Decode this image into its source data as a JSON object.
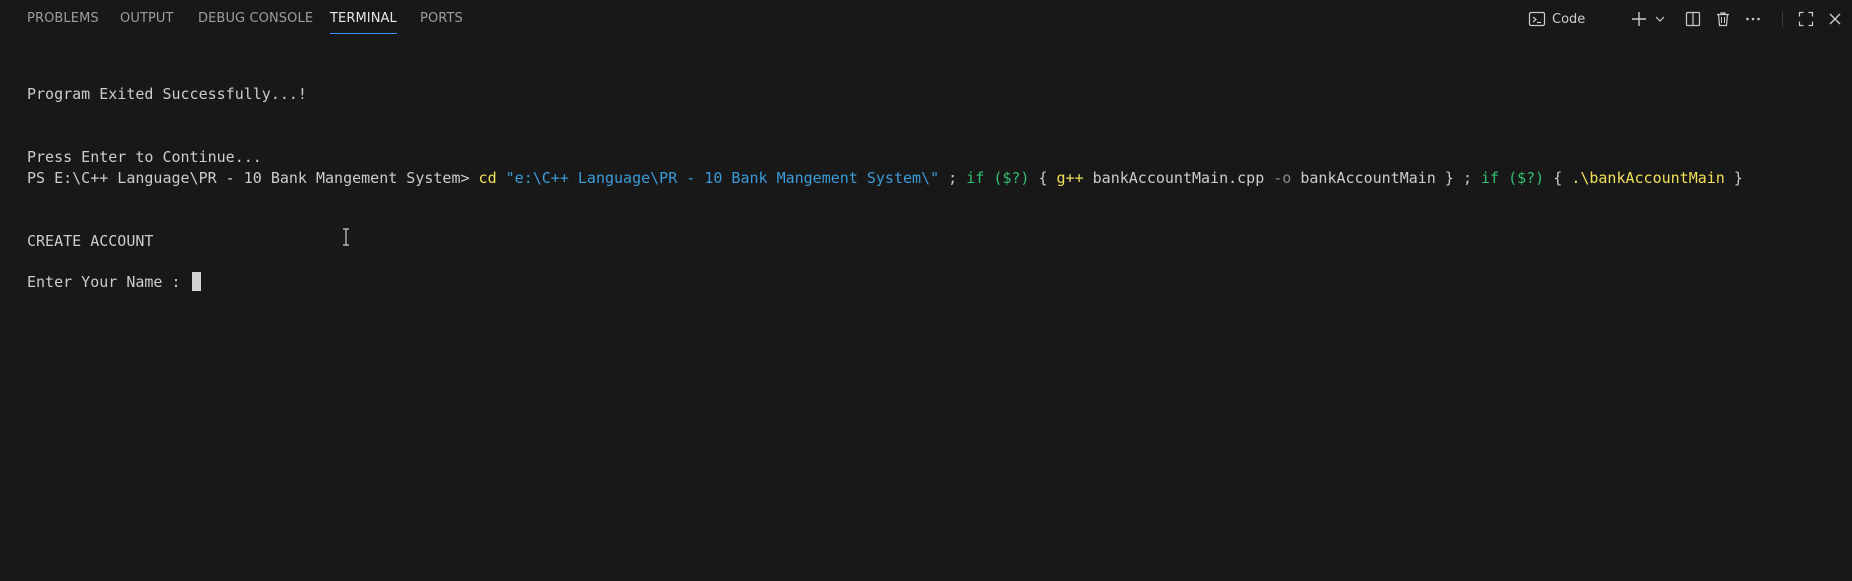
{
  "panel": {
    "tabs": [
      {
        "label": "PROBLEMS"
      },
      {
        "label": "OUTPUT"
      },
      {
        "label": "DEBUG CONSOLE"
      },
      {
        "label": "TERMINAL",
        "active": true
      },
      {
        "label": "PORTS"
      }
    ],
    "actions": {
      "terminal_profile_label": "Code",
      "icons": [
        "terminal-icon",
        "plus-icon",
        "chevron-down-icon",
        "split-icon",
        "trash-icon",
        "more-icon",
        "maximize-icon",
        "close-icon"
      ]
    }
  },
  "terminal": {
    "line1": "Program Exited Successfully...!",
    "line2": "Press Enter to Continue...",
    "prompt": "PS E:\\C++ Language\\PR - 10 Bank Mangement System>",
    "cmd": {
      "cd": "cd",
      "path": "\"e:\\C++ Language\\PR - 10 Bank Mangement System\\\"",
      "sep1": ";",
      "if1": "if",
      "cond1": "($?)",
      "brace_open1": "{",
      "compiler": "g++",
      "source": "bankAccountMain.cpp",
      "flag": "-o",
      "output": "bankAccountMain",
      "brace_close1": "}",
      "sep2": ";",
      "if2": "if",
      "cond2": "($?)",
      "brace_open2": "{",
      "exe": ".\\bankAccountMain",
      "brace_close2": "}"
    },
    "heading": "CREATE ACCOUNT",
    "input_prompt": "Enter Your Name : "
  },
  "colors": {
    "background": "#181818",
    "text": "#cccccc",
    "command_yellow": "#f1e05a",
    "string_blue": "#3b9bd8",
    "keyword_green": "#2fbf71",
    "active_tab_underline": "#3794ff"
  }
}
